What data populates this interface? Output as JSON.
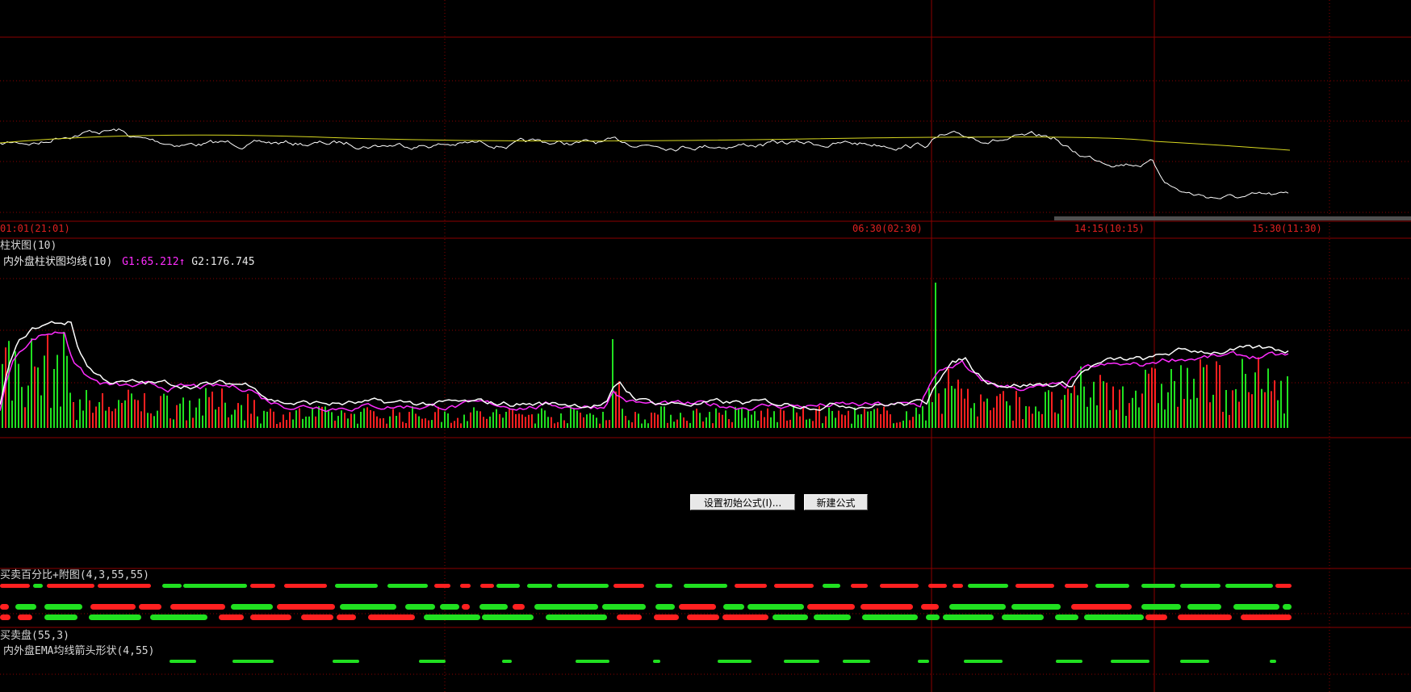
{
  "price_panel": {
    "time_labels": [
      "01:01(21:01)",
      "06:30(02:30)",
      "14:15(10:15)",
      "15:30(11:30)"
    ]
  },
  "volume_panel": {
    "title": "柱状图(10)",
    "subtitle": "内外盘柱状图均线(10)",
    "g1": "G1:65.212",
    "g1_arrow": "↑",
    "g2": "G2:176.745"
  },
  "empty_panel": {
    "set_formula_button": "设置初始公式(I)...",
    "new_formula_button": "新建公式(N)"
  },
  "percent_panel": {
    "title": "买卖百分比+附图(4,3,55,55)"
  },
  "buysell_panel": {
    "title": "买卖盘(55,3)",
    "subtitle": "内外盘EMA均线箭头形状(4,55)"
  },
  "colors": {
    "background": "#000000",
    "grid_line": "#8b0000",
    "up_red": "#ff2020",
    "down_green": "#20e020",
    "avg_magenta": "#ff2cff",
    "price_white": "#ffffff",
    "ma_yellow": "#d8d820"
  }
}
